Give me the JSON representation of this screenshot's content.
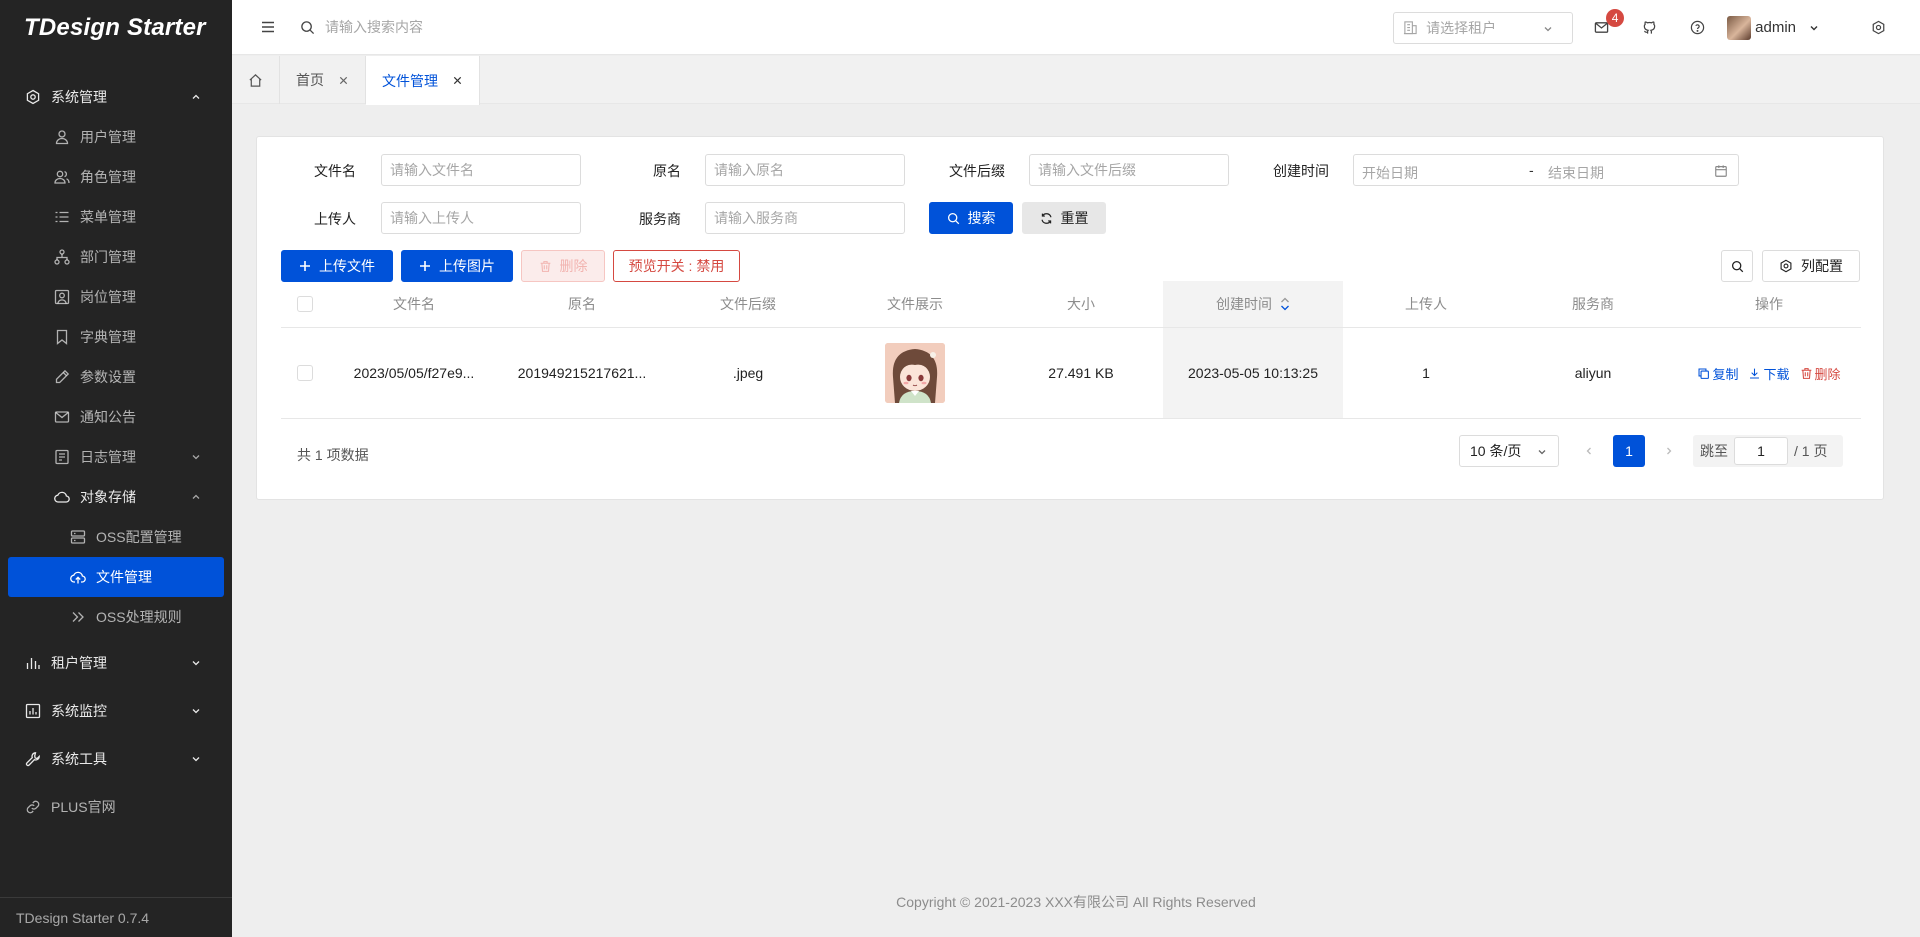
{
  "app": {
    "logo_text": "TDesign Starter",
    "version": "TDesign Starter 0.7.4"
  },
  "sidebar": {
    "groups": [
      {
        "label": "系统管理",
        "icon": "settings-icon",
        "expanded": true
      },
      {
        "label": "租户管理",
        "icon": "chart-bar-icon",
        "expanded": false
      },
      {
        "label": "系统监控",
        "icon": "monitor-chart-icon",
        "expanded": false
      },
      {
        "label": "系统工具",
        "icon": "tool-icon",
        "expanded": false
      },
      {
        "label": "PLUS官网",
        "icon": "link-icon"
      }
    ],
    "system_items": [
      {
        "label": "用户管理",
        "icon": "user-icon"
      },
      {
        "label": "角色管理",
        "icon": "users-icon"
      },
      {
        "label": "菜单管理",
        "icon": "menu-list-icon"
      },
      {
        "label": "部门管理",
        "icon": "org-icon"
      },
      {
        "label": "岗位管理",
        "icon": "user-square-icon"
      },
      {
        "label": "字典管理",
        "icon": "bookmark-icon"
      },
      {
        "label": "参数设置",
        "icon": "edit-icon"
      },
      {
        "label": "通知公告",
        "icon": "mail-icon"
      },
      {
        "label": "日志管理",
        "icon": "file-icon",
        "expanded": false
      },
      {
        "label": "对象存储",
        "icon": "cloud-icon",
        "expanded": true
      }
    ],
    "storage_items": [
      {
        "label": "OSS配置管理",
        "icon": "server-icon"
      },
      {
        "label": "文件管理",
        "icon": "cloud-upload-icon",
        "active": true
      },
      {
        "label": "OSS处理规则",
        "icon": "chevrons-right-icon"
      }
    ]
  },
  "header": {
    "search_placeholder": "请输入搜索内容",
    "tenant_placeholder": "请选择租户",
    "notification_count": "4",
    "username": "admin"
  },
  "tabs": [
    {
      "label": "首页"
    },
    {
      "label": "文件管理",
      "active": true
    }
  ],
  "filters": {
    "file_name": {
      "label": "文件名",
      "placeholder": "请输入文件名"
    },
    "original_name": {
      "label": "原名",
      "placeholder": "请输入原名"
    },
    "suffix": {
      "label": "文件后缀",
      "placeholder": "请输入文件后缀"
    },
    "created": {
      "label": "创建时间",
      "start_placeholder": "开始日期",
      "separator": "-",
      "end_placeholder": "结束日期"
    },
    "uploader": {
      "label": "上传人",
      "placeholder": "请输入上传人"
    },
    "provider": {
      "label": "服务商",
      "placeholder": "请输入服务商"
    },
    "search_button": "搜索",
    "reset_button": "重置"
  },
  "toolbar": {
    "upload_file": "上传文件",
    "upload_image": "上传图片",
    "delete": "删除",
    "preview_toggle": "预览开关 : 禁用",
    "column_config": "列配置"
  },
  "table": {
    "columns": [
      "文件名",
      "原名",
      "文件后缀",
      "文件展示",
      "大小",
      "创建时间",
      "上传人",
      "服务商",
      "操作"
    ],
    "sorted_column": "创建时间",
    "rows": [
      {
        "file_name": "2023/05/05/f27e9...",
        "original_name": "201949215217621...",
        "suffix": ".jpeg",
        "preview": "anime-girl-thumbnail",
        "size": "27.491 KB",
        "created": "2023-05-05 10:13:25",
        "uploader": "1",
        "provider": "aliyun",
        "actions": {
          "copy": "复制",
          "download": "下载",
          "delete": "删除"
        }
      }
    ]
  },
  "pagination": {
    "total_text": "共 1 项数据",
    "page_size": "10 条/页",
    "current_page": "1",
    "jump_label": "跳至",
    "jump_value": "1",
    "page_total": "/ 1 页"
  },
  "footer": {
    "copyright": "Copyright © 2021-2023 XXX有限公司 All Rights Reserved"
  },
  "colors": {
    "primary": "#0052d9",
    "danger": "#d54941",
    "sidebar_bg": "#242424",
    "page_bg": "#eeeeee"
  }
}
